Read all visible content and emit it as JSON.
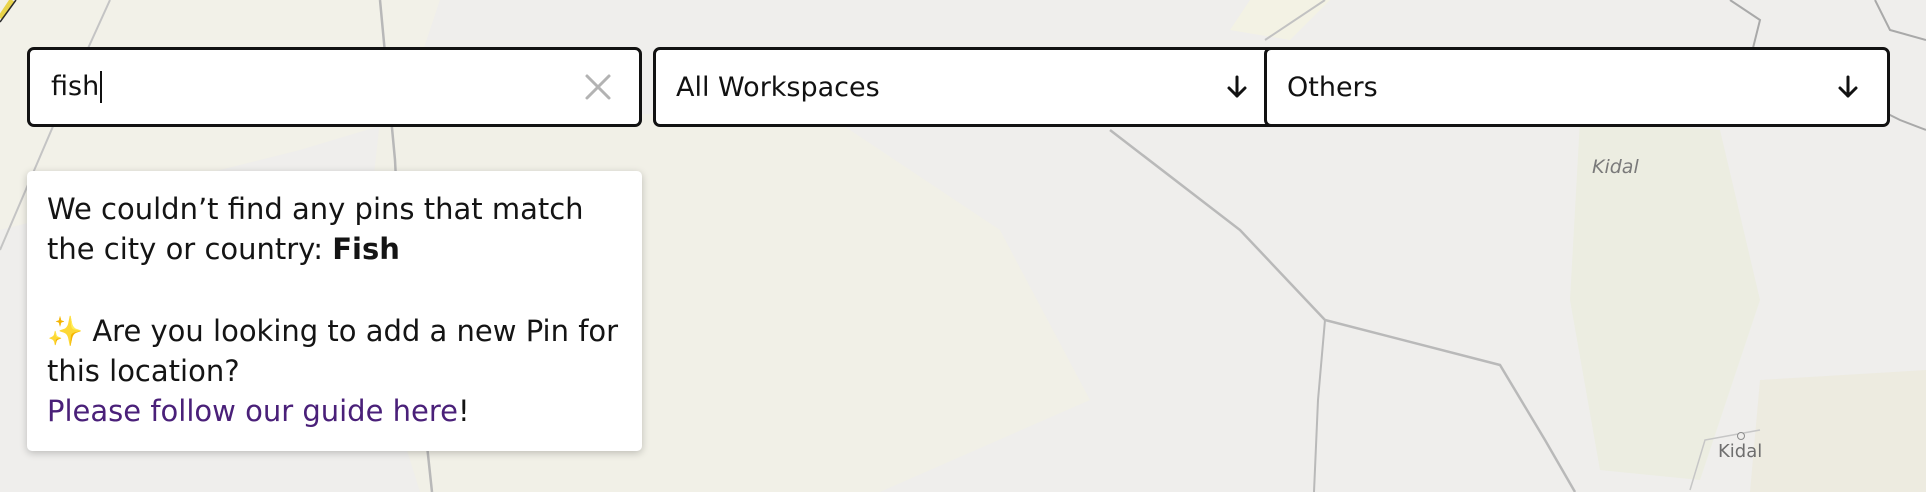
{
  "search": {
    "value": "fish",
    "clear_icon": "close-icon"
  },
  "workspace_filter": {
    "selected": "All Workspaces",
    "icon": "arrow-down-icon"
  },
  "category_filter": {
    "selected": "Others",
    "icon": "arrow-down-icon"
  },
  "no_results": {
    "message_prefix": "We couldn’t find any pins that match the city or country: ",
    "query_term": "Fish",
    "sparkle_icon": "✨",
    "suggestion": " Are you looking to add a new Pin for this location?",
    "guide_link": "Please follow our guide here",
    "guide_suffix": "!"
  },
  "map": {
    "region_label": "Kidal",
    "city_label": "Kidal",
    "background": "#efeeec",
    "accent": "#4a2079"
  }
}
